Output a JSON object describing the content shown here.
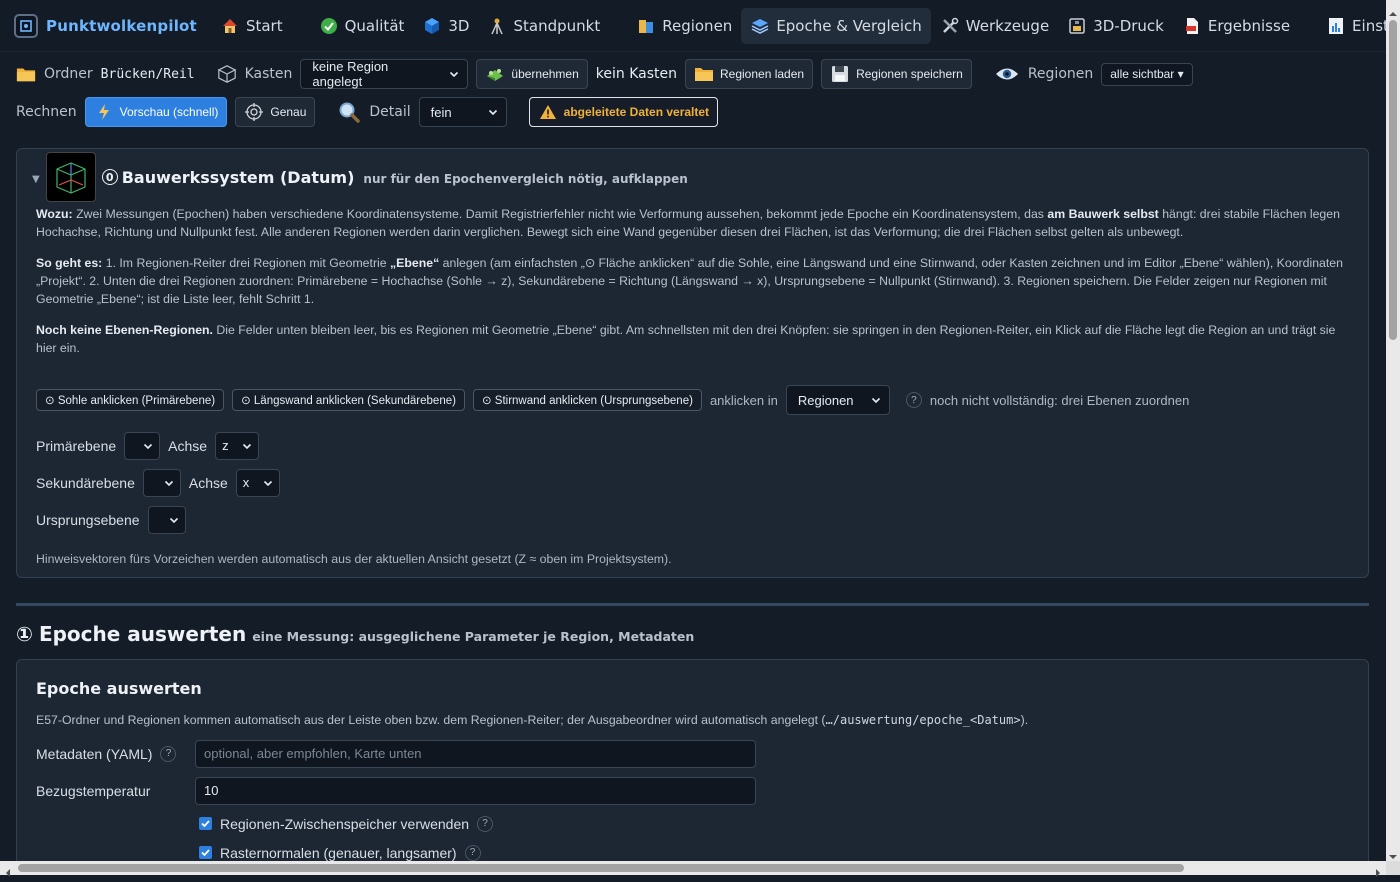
{
  "app": {
    "name": "Punktwolkenpilot"
  },
  "nav": {
    "start": "Start",
    "qualitaet": "Qualität",
    "dreid": "3D",
    "standpunkt": "Standpunkt",
    "regionen": "Regionen",
    "epoche": "Epoche & Vergleich",
    "werkzeuge": "Werkzeuge",
    "druck": "3D-Druck",
    "ergebnisse": "Ergebnisse",
    "einstellungen": "Einstellungen"
  },
  "toolbar1": {
    "ordner_label": "Ordner",
    "ordner_value": "Brücken/Reil",
    "kasten_label": "Kasten",
    "kasten_select": "keine Region angelegt",
    "uebernehmen": "übernehmen",
    "kein_kasten": "kein Kasten",
    "regionen_laden": "Regionen laden",
    "regionen_speichern": "Regionen speichern",
    "regionen_label": "Regionen",
    "sichtbar": "alle sichtbar ▾"
  },
  "toolbar2": {
    "rechnen": "Rechnen",
    "vorschau": "Vorschau (schnell)",
    "genau": "Genau",
    "detail_label": "Detail",
    "detail_value": "fein",
    "veraltet": "abgeleitete Daten veraltet"
  },
  "datum": {
    "num": "0",
    "title": "Bauwerkssystem (Datum)",
    "subtitle": "nur für den Epochenvergleich nötig, aufklappen",
    "wozu_label": "Wozu:",
    "wozu_text1": " Zwei Messungen (Epochen) haben verschiedene Koordinatensysteme. Damit Registrierfehler nicht wie Verformung aussehen, bekommt jede Epoche ein Koordinatensystem, das ",
    "wozu_bold": "am Bauwerk selbst",
    "wozu_text2": " hängt: drei stabile Flächen legen Hochachse, Richtung und Nullpunkt fest. Alle anderen Regionen werden darin verglichen. Bewegt sich eine Wand gegenüber diesen drei Flächen, ist das Verformung; die drei Flächen selbst gelten als unbewegt.",
    "sogehts_label": "So geht es:",
    "sogehts_text1": " 1. Im Regionen-Reiter drei Regionen mit Geometrie ",
    "sogehts_bold": "„Ebene“",
    "sogehts_text2": " anlegen (am einfachsten „⊙ Fläche anklicken“ auf die Sohle, eine Längswand und eine Stirnwand, oder Kasten zeichnen und im Editor „Ebene“ wählen), Koordinaten „Projekt“. 2. Unten die drei Regionen zuordnen: Primärebene = Hochachse (Sohle → z), Sekundärebene = Richtung (Längswand → x), Ursprungsebene = Nullpunkt (Stirnwand). 3. Regionen speichern. Die Felder zeigen nur Regionen mit Geometrie „Ebene“; ist die Liste leer, fehlt Schritt 1.",
    "noch_bold": "Noch keine Ebenen-Regionen.",
    "noch_text": " Die Felder unten bleiben leer, bis es Regionen mit Geometrie „Ebene“ gibt. Am schnellsten mit den drei Knöpfen: sie springen in den Regionen-Reiter, ein Klick auf die Fläche legt die Region an und trägt sie hier ein.",
    "chip_sohle": "⊙ Sohle anklicken (Primärebene)",
    "chip_laengs": "⊙ Längswand anklicken (Sekundärebene)",
    "chip_stirn": "⊙ Stirnwand anklicken (Ursprungsebene)",
    "anklicken_in": "anklicken in",
    "anklicken_select": "Regionen",
    "q": "?",
    "status": "noch nicht vollständig: drei Ebenen zuordnen",
    "primaer": "Primärebene",
    "achse": "Achse",
    "achse1": "z",
    "sekundaer": "Sekundärebene",
    "achse2": "x",
    "ursprung": "Ursprungsebene",
    "hint": "Hinweisvektoren fürs Vorzeichen werden automatisch aus der aktuellen Ansicht gesetzt (Z ≈ oben im Projektsystem)."
  },
  "epoche": {
    "num": "①",
    "title": "Epoche auswerten",
    "subtitle": "eine Messung: ausgeglichene Parameter je Region, Metadaten",
    "card_title": "Epoche auswerten",
    "desc1": "E57-Ordner und Regionen kommen automatisch aus der Leiste oben bzw. dem Regionen-Reiter; der Ausgabeordner wird automatisch angelegt (",
    "desc_mono": "…/auswertung/epoche_<Datum>",
    "desc2": ").",
    "meta_label": "Metadaten (YAML)",
    "meta_placeholder": "optional, aber empfohlen, Karte unten",
    "temp_label": "Bezugstemperatur",
    "temp_value": "10",
    "cb1": "Regionen-Zwischenspeicher verwenden",
    "cb2": "Rasternormalen (genauer, langsamer)"
  },
  "colors": {
    "accent": "#2d7fe0",
    "warn": "#f0b23a",
    "brand": "#6fb6ff"
  }
}
